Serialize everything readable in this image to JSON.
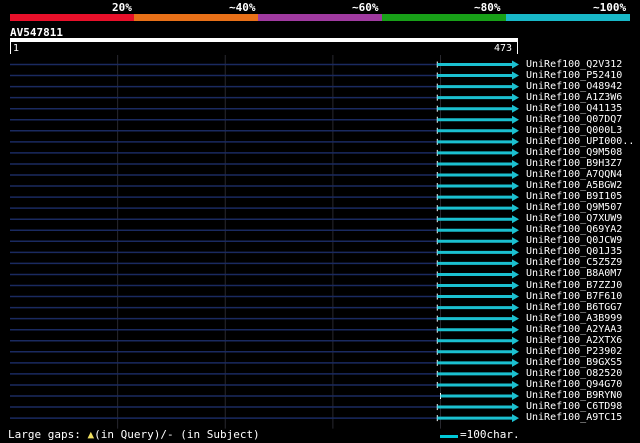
{
  "query": {
    "name": "AV547811",
    "start": "1",
    "end": "473",
    "length": 473
  },
  "legend": {
    "labels": [
      "20%",
      "~40%",
      "~60%",
      "~80%",
      "~100%"
    ],
    "colors": [
      "#e8102a",
      "#e87018",
      "#a03aa0",
      "#18a018",
      "#18b8c8"
    ]
  },
  "grid": {
    "line_color": "#28282f"
  },
  "hits": [
    {
      "name": "UniRef100_Q2V312",
      "q_start": 398,
      "q_end": 473,
      "color": "#1bc0d0",
      "gap_mark": false
    },
    {
      "name": "UniRef100_P52410",
      "q_start": 398,
      "q_end": 473,
      "color": "#1bc0d0",
      "gap_mark": false
    },
    {
      "name": "UniRef100_O48942",
      "q_start": 398,
      "q_end": 473,
      "color": "#1bc0d0",
      "gap_mark": false
    },
    {
      "name": "UniRef100_A1Z3W6",
      "q_start": 398,
      "q_end": 473,
      "color": "#1bc0d0",
      "gap_mark": false
    },
    {
      "name": "UniRef100_Q41135",
      "q_start": 398,
      "q_end": 473,
      "color": "#1bc0d0",
      "gap_mark": false
    },
    {
      "name": "UniRef100_Q07DQ7",
      "q_start": 398,
      "q_end": 473,
      "color": "#1bc0d0",
      "gap_mark": false
    },
    {
      "name": "UniRef100_Q000L3",
      "q_start": 398,
      "q_end": 473,
      "color": "#1bc0d0",
      "gap_mark": false
    },
    {
      "name": "UniRef100_UPI000..",
      "q_start": 398,
      "q_end": 473,
      "color": "#1bc0d0",
      "gap_mark": false
    },
    {
      "name": "UniRef100_Q9M508",
      "q_start": 398,
      "q_end": 473,
      "color": "#1bc0d0",
      "gap_mark": false
    },
    {
      "name": "UniRef100_B9H3Z7",
      "q_start": 398,
      "q_end": 473,
      "color": "#1bc0d0",
      "gap_mark": false
    },
    {
      "name": "UniRef100_A7QQN4",
      "q_start": 398,
      "q_end": 473,
      "color": "#1bc0d0",
      "gap_mark": false
    },
    {
      "name": "UniRef100_A5BGW2",
      "q_start": 398,
      "q_end": 473,
      "color": "#1bc0d0",
      "gap_mark": false
    },
    {
      "name": "UniRef100_B9I105",
      "q_start": 398,
      "q_end": 473,
      "color": "#1bc0d0",
      "gap_mark": false
    },
    {
      "name": "UniRef100_Q9M507",
      "q_start": 398,
      "q_end": 473,
      "color": "#1bc0d0",
      "gap_mark": false
    },
    {
      "name": "UniRef100_Q7XUW9",
      "q_start": 398,
      "q_end": 473,
      "color": "#1bc0d0",
      "gap_mark": false
    },
    {
      "name": "UniRef100_Q69YA2",
      "q_start": 398,
      "q_end": 473,
      "color": "#1bc0d0",
      "gap_mark": false
    },
    {
      "name": "UniRef100_Q0JCW9",
      "q_start": 398,
      "q_end": 473,
      "color": "#1bc0d0",
      "gap_mark": false
    },
    {
      "name": "UniRef100_Q01J35",
      "q_start": 398,
      "q_end": 473,
      "color": "#1bc0d0",
      "gap_mark": false
    },
    {
      "name": "UniRef100_C5Z5Z9",
      "q_start": 398,
      "q_end": 473,
      "color": "#1bc0d0",
      "gap_mark": false
    },
    {
      "name": "UniRef100_B8A0M7",
      "q_start": 398,
      "q_end": 473,
      "color": "#1bc0d0",
      "gap_mark": false
    },
    {
      "name": "UniRef100_B7ZZJ0",
      "q_start": 398,
      "q_end": 473,
      "color": "#1bc0d0",
      "gap_mark": false
    },
    {
      "name": "UniRef100_B7F610",
      "q_start": 398,
      "q_end": 473,
      "color": "#1bc0d0",
      "gap_mark": false
    },
    {
      "name": "UniRef100_B6TGG7",
      "q_start": 398,
      "q_end": 473,
      "color": "#1bc0d0",
      "gap_mark": false
    },
    {
      "name": "UniRef100_A3B999",
      "q_start": 398,
      "q_end": 473,
      "color": "#1bc0d0",
      "gap_mark": false
    },
    {
      "name": "UniRef100_A2YAA3",
      "q_start": 398,
      "q_end": 473,
      "color": "#1bc0d0",
      "gap_mark": false
    },
    {
      "name": "UniRef100_A2XTX6",
      "q_start": 398,
      "q_end": 473,
      "color": "#1bc0d0",
      "gap_mark": false
    },
    {
      "name": "UniRef100_P23902",
      "q_start": 398,
      "q_end": 473,
      "color": "#1bc0d0",
      "gap_mark": false
    },
    {
      "name": "UniRef100_B9GXS5",
      "q_start": 398,
      "q_end": 473,
      "color": "#1bc0d0",
      "gap_mark": false
    },
    {
      "name": "UniRef100_O82520",
      "q_start": 398,
      "q_end": 473,
      "color": "#1bc0d0",
      "gap_mark": false
    },
    {
      "name": "UniRef100_Q94G70",
      "q_start": 398,
      "q_end": 473,
      "color": "#1bc0d0",
      "gap_mark": false
    },
    {
      "name": "UniRef100_B9RYN0",
      "q_start": 401,
      "q_end": 473,
      "color": "#1bc0d0",
      "gap_mark": true
    },
    {
      "name": "UniRef100_C6TD98",
      "q_start": 398,
      "q_end": 473,
      "color": "#1bc0d0",
      "gap_mark": false
    },
    {
      "name": "UniRef100_A9TC15",
      "q_start": 398,
      "q_end": 473,
      "color": "#1bc0d0",
      "gap_mark": false
    }
  ],
  "footer": {
    "gaps_text": "Large gaps:",
    "gaps_query": "(in Query)/",
    "gaps_subject": "- (in Subject)",
    "scale_text": "=100char."
  }
}
